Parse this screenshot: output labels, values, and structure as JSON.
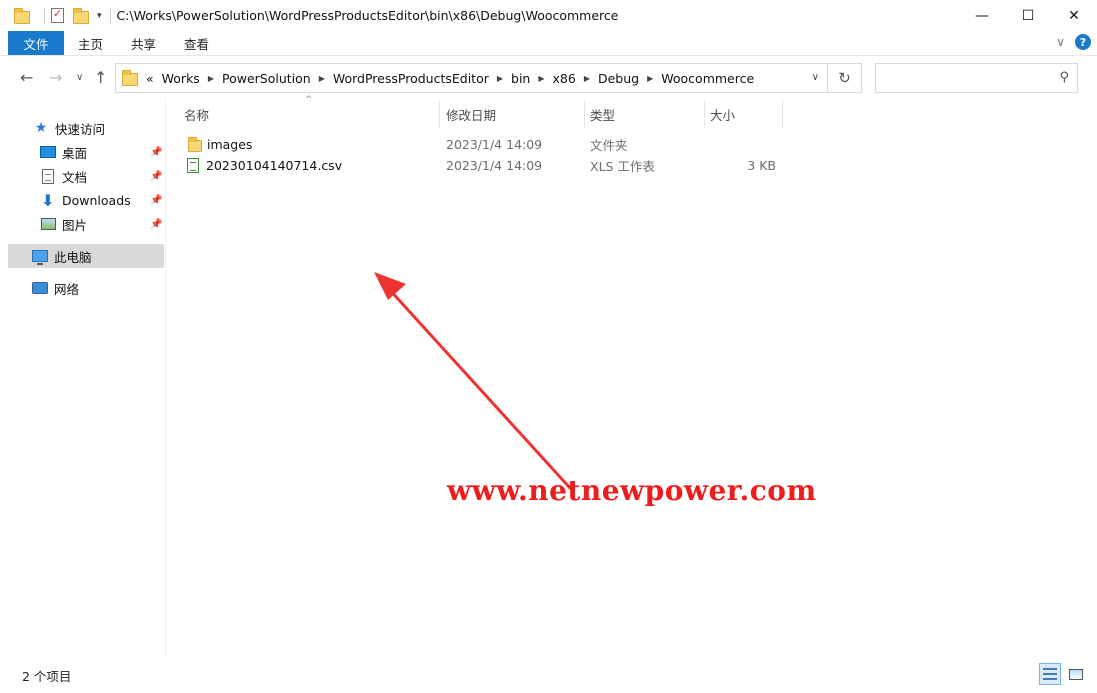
{
  "window": {
    "title": "C:\\Works\\PowerSolution\\WordPressProductsEditor\\bin\\x86\\Debug\\Woocommerce",
    "minimize": "—",
    "maximize": "☐",
    "close": "✕"
  },
  "ribbon": {
    "tabs": [
      "文件",
      "主页",
      "共享",
      "查看"
    ],
    "help": "?"
  },
  "address": {
    "overflow": "«",
    "crumbs": [
      "Works",
      "PowerSolution",
      "WordPressProductsEditor",
      "bin",
      "x86",
      "Debug",
      "Woocommerce"
    ],
    "search_placeholder": ""
  },
  "sidebar": {
    "quick_access": "快速访问",
    "items": [
      "桌面",
      "文档",
      "Downloads",
      "图片"
    ],
    "this_pc": "此电脑",
    "network": "网络"
  },
  "columns": {
    "name": "名称",
    "date": "修改日期",
    "type": "类型",
    "size": "大小"
  },
  "files": [
    {
      "name": "images",
      "date": "2023/1/4 14:09",
      "type": "文件夹",
      "size": "",
      "icon": "folder-icon"
    },
    {
      "name": "20230104140714.csv",
      "date": "2023/1/4 14:09",
      "type": "XLS 工作表",
      "size": "3 KB",
      "icon": "csv-file-icon"
    }
  ],
  "watermark": "www.netnewpower.com",
  "status": {
    "item_count": "2 个项目"
  },
  "colors": {
    "accent": "#1979ca",
    "watermark": "#ee1c1c",
    "selection": "#d9d9d9"
  }
}
